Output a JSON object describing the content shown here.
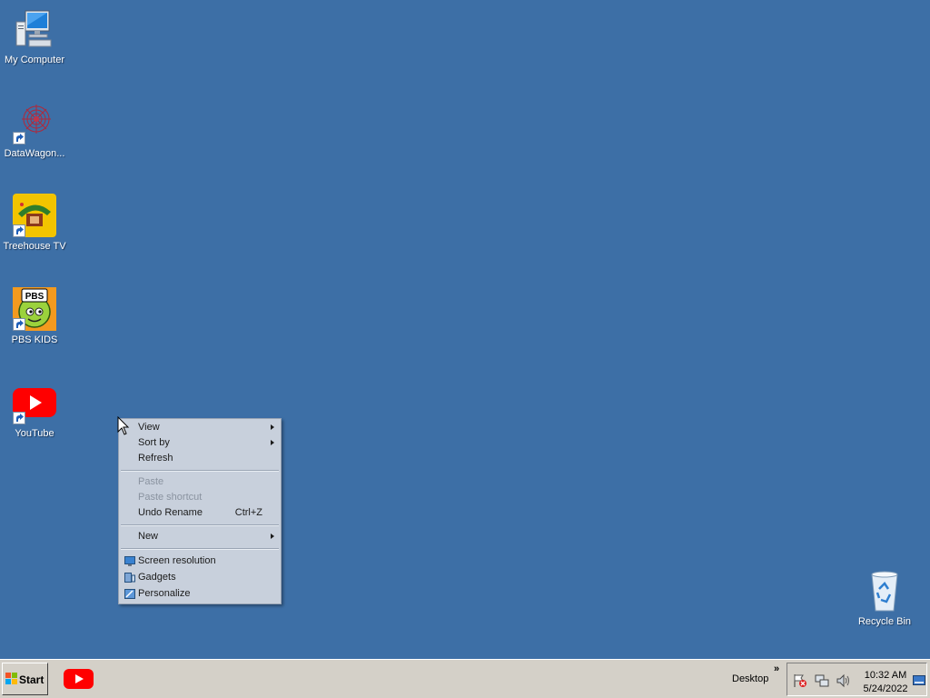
{
  "desktop": {
    "icons": [
      {
        "label": "My Computer",
        "name": "my-computer-icon"
      },
      {
        "label": "DataWagon...",
        "name": "datawagon-icon"
      },
      {
        "label": "Treehouse TV",
        "name": "treehouse-tv-icon"
      },
      {
        "label": "PBS KIDS",
        "name": "pbs-kids-icon"
      },
      {
        "label": "YouTube",
        "name": "youtube-icon"
      },
      {
        "label": "Recycle Bin",
        "name": "recycle-bin-icon"
      }
    ],
    "pbs_logo_text": "PBS"
  },
  "context_menu": {
    "view": "View",
    "sort_by": "Sort by",
    "refresh": "Refresh",
    "paste": "Paste",
    "paste_shortcut": "Paste shortcut",
    "undo_rename": "Undo Rename",
    "undo_shortcut": "Ctrl+Z",
    "new": "New",
    "screen_resolution": "Screen resolution",
    "gadgets": "Gadgets",
    "personalize": "Personalize"
  },
  "taskbar": {
    "start": "Start",
    "toolbar_label": "Desktop",
    "chevron": "»",
    "time": "10:32 AM",
    "date": "5/24/2022"
  },
  "colors": {
    "desktop_bg": "#3d6fa6",
    "menu_bg": "#c8d0dc",
    "taskbar_bg": "#d4d0c8",
    "youtube_red": "#ff0000"
  }
}
